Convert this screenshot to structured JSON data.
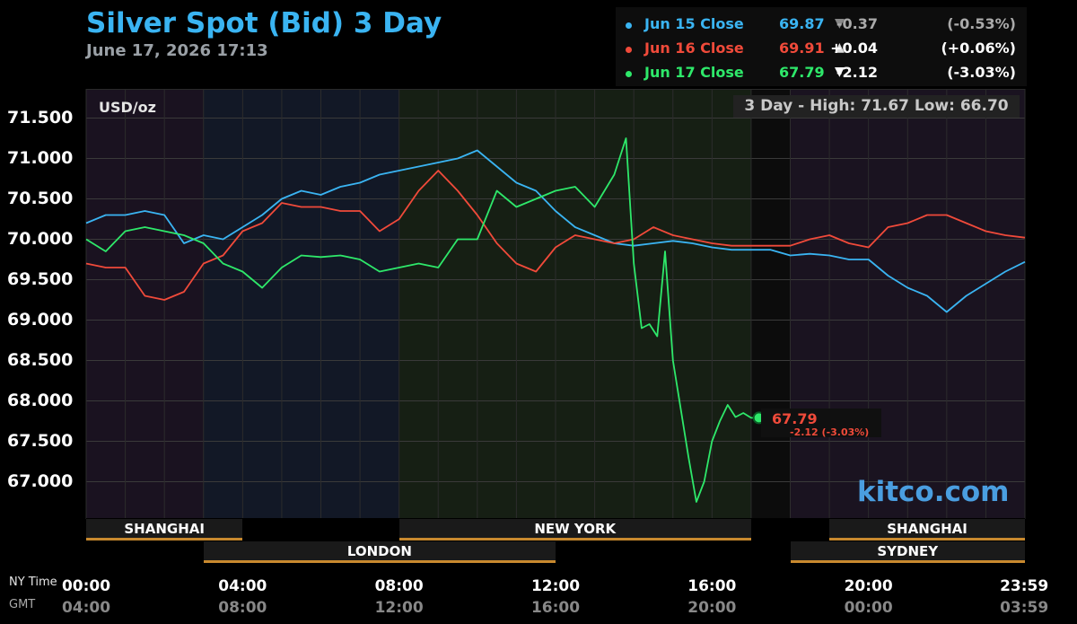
{
  "header": {
    "title": "Silver Spot (Bid) 3 Day",
    "timestamp": "June 17, 2026 17:13"
  },
  "legend": [
    {
      "name": "Jun 15 Close",
      "close": "69.87",
      "arrow": "▼",
      "change": "-0.37",
      "percent": "(-0.53%)",
      "color": "#3ab4f2"
    },
    {
      "name": "Jun 16 Close",
      "close": "69.91",
      "arrow": "▲",
      "change": "+0.04",
      "percent": "(+0.06%)",
      "color": "#f04a3a"
    },
    {
      "name": "Jun 17 Close",
      "close": "67.79",
      "arrow": "▼",
      "change": "-2.12",
      "percent": "(-3.03%)",
      "color": "#2ee86a"
    }
  ],
  "unit_label": "USD/oz",
  "high_low": "3 Day - High: 71.67  Low: 66.70",
  "watermark": "kitco.com",
  "current_point": {
    "value": "67.79",
    "change": "-2.12 (-3.03%)"
  },
  "axis_captions": {
    "ny": "NY Time",
    "gmt": "GMT"
  },
  "sessions": [
    {
      "name": "SHANGHAI",
      "start": 0,
      "end": 4,
      "row": 1
    },
    {
      "name": "NEW YORK",
      "start": 8,
      "end": 17,
      "row": 1
    },
    {
      "name": "SHANGHAI",
      "start": 19,
      "end": 24,
      "row": 1
    },
    {
      "name": "LONDON",
      "start": 3,
      "end": 12,
      "row": 2
    },
    {
      "name": "SYDNEY",
      "start": 18,
      "end": 24,
      "row": 2
    }
  ],
  "chart_data": {
    "type": "line",
    "ylabel": "USD/oz",
    "ylim": [
      66.55,
      71.85
    ],
    "y_ticks": [
      "71.500",
      "71.000",
      "70.500",
      "70.000",
      "69.500",
      "69.000",
      "68.500",
      "68.000",
      "67.500",
      "67.000"
    ],
    "x_ticks_ny": [
      "00:00",
      "04:00",
      "08:00",
      "12:00",
      "16:00",
      "20:00",
      "23:59"
    ],
    "x_ticks_gmt": [
      "04:00",
      "08:00",
      "12:00",
      "16:00",
      "20:00",
      "00:00",
      "03:59"
    ],
    "x_tick_hours": [
      0,
      4,
      8,
      12,
      16,
      20,
      23.98
    ],
    "series": [
      {
        "name": "Jun 15 Close",
        "color": "#3ab4f2",
        "x": [
          0,
          0.5,
          1,
          1.5,
          2,
          2.5,
          3,
          3.5,
          4,
          4.5,
          5,
          5.5,
          6,
          6.5,
          7,
          7.5,
          8,
          8.5,
          9,
          9.5,
          10,
          10.5,
          11,
          11.5,
          12,
          12.5,
          13,
          13.5,
          14,
          14.5,
          15,
          15.5,
          16,
          16.5,
          17,
          17.5,
          18,
          18.5,
          19,
          19.5,
          20,
          20.5,
          21,
          21.5,
          22,
          22.5,
          23,
          23.5,
          24
        ],
        "y": [
          70.2,
          70.3,
          70.3,
          70.35,
          70.3,
          69.95,
          70.05,
          70.0,
          70.15,
          70.3,
          70.5,
          70.6,
          70.55,
          70.65,
          70.7,
          70.8,
          70.85,
          70.9,
          70.95,
          71.0,
          71.1,
          70.9,
          70.7,
          70.6,
          70.35,
          70.15,
          70.05,
          69.95,
          69.92,
          69.95,
          69.98,
          69.95,
          69.9,
          69.87,
          69.87,
          69.87,
          69.8,
          69.82,
          69.8,
          69.75,
          69.75,
          69.55,
          69.4,
          69.3,
          69.1,
          69.3,
          69.45,
          69.6,
          69.72
        ]
      },
      {
        "name": "Jun 16 Close",
        "color": "#f04a3a",
        "x": [
          0,
          0.5,
          1,
          1.5,
          2,
          2.5,
          3,
          3.5,
          4,
          4.5,
          5,
          5.5,
          6,
          6.5,
          7,
          7.5,
          8,
          8.5,
          9,
          9.5,
          10,
          10.5,
          11,
          11.5,
          12,
          12.5,
          13,
          13.5,
          14,
          14.5,
          15,
          15.5,
          16,
          16.5,
          17,
          17.5,
          18,
          18.5,
          19,
          19.5,
          20,
          20.5,
          21,
          21.5,
          22,
          22.5,
          23,
          23.5,
          24
        ],
        "y": [
          69.7,
          69.65,
          69.65,
          69.3,
          69.25,
          69.35,
          69.7,
          69.8,
          70.1,
          70.2,
          70.45,
          70.4,
          70.4,
          70.35,
          70.35,
          70.1,
          70.25,
          70.6,
          70.85,
          70.6,
          70.3,
          69.95,
          69.7,
          69.6,
          69.9,
          70.05,
          70.0,
          69.95,
          70.0,
          70.15,
          70.05,
          70.0,
          69.95,
          69.92,
          69.92,
          69.92,
          69.92,
          70.0,
          70.05,
          69.95,
          69.9,
          70.15,
          70.2,
          70.3,
          70.3,
          70.2,
          70.1,
          70.05,
          70.02
        ]
      },
      {
        "name": "Jun 17 Close",
        "color": "#2ee86a",
        "x": [
          0,
          0.5,
          1,
          1.5,
          2,
          2.5,
          3,
          3.5,
          4,
          4.5,
          5,
          5.5,
          6,
          6.5,
          7,
          7.5,
          8,
          8.5,
          9,
          9.5,
          10,
          10.5,
          11,
          11.5,
          12,
          12.5,
          13,
          13.5,
          13.8,
          14,
          14.2,
          14.4,
          14.6,
          14.8,
          15,
          15.2,
          15.4,
          15.6,
          15.8,
          16,
          16.2,
          16.4,
          16.6,
          16.8,
          17.0,
          17.2
        ],
        "y": [
          70.0,
          69.85,
          70.1,
          70.15,
          70.1,
          70.05,
          69.95,
          69.7,
          69.6,
          69.4,
          69.65,
          69.8,
          69.78,
          69.8,
          69.75,
          69.6,
          69.65,
          69.7,
          69.65,
          70.0,
          70.0,
          70.6,
          70.4,
          70.5,
          70.6,
          70.65,
          70.4,
          70.8,
          71.25,
          69.7,
          68.9,
          68.95,
          68.8,
          69.85,
          68.5,
          67.9,
          67.3,
          66.75,
          67.0,
          67.5,
          67.75,
          67.95,
          67.8,
          67.85,
          67.79,
          67.79
        ]
      }
    ]
  }
}
